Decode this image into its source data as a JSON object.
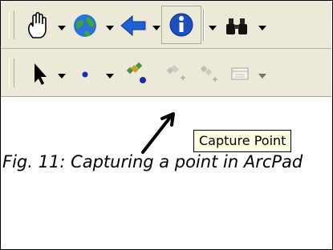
{
  "toolbar_top": {
    "items": [
      {
        "name": "pan-hand-icon"
      },
      {
        "name": "globe-icon"
      },
      {
        "name": "back-arrow-icon"
      },
      {
        "name": "info-icon"
      },
      {
        "name": "binoculars-icon"
      }
    ]
  },
  "toolbar_bottom": {
    "items": [
      {
        "name": "select-pointer-icon"
      },
      {
        "name": "point-dot-icon"
      },
      {
        "name": "capture-point-icon"
      },
      {
        "name": "add-vertex-icon"
      },
      {
        "name": "capture-vertex-icon"
      },
      {
        "name": "attribute-table-icon"
      }
    ]
  },
  "tooltip": {
    "text": "Capture Point"
  },
  "caption": {
    "text": "Fig. 11: Capturing a point in ArcPad"
  },
  "colors": {
    "toolbar_bg": "#ece9d8",
    "tooltip_bg": "#ffffe1",
    "arrow_blue": "#1e5fd6",
    "dropdown_black": "#000000"
  }
}
